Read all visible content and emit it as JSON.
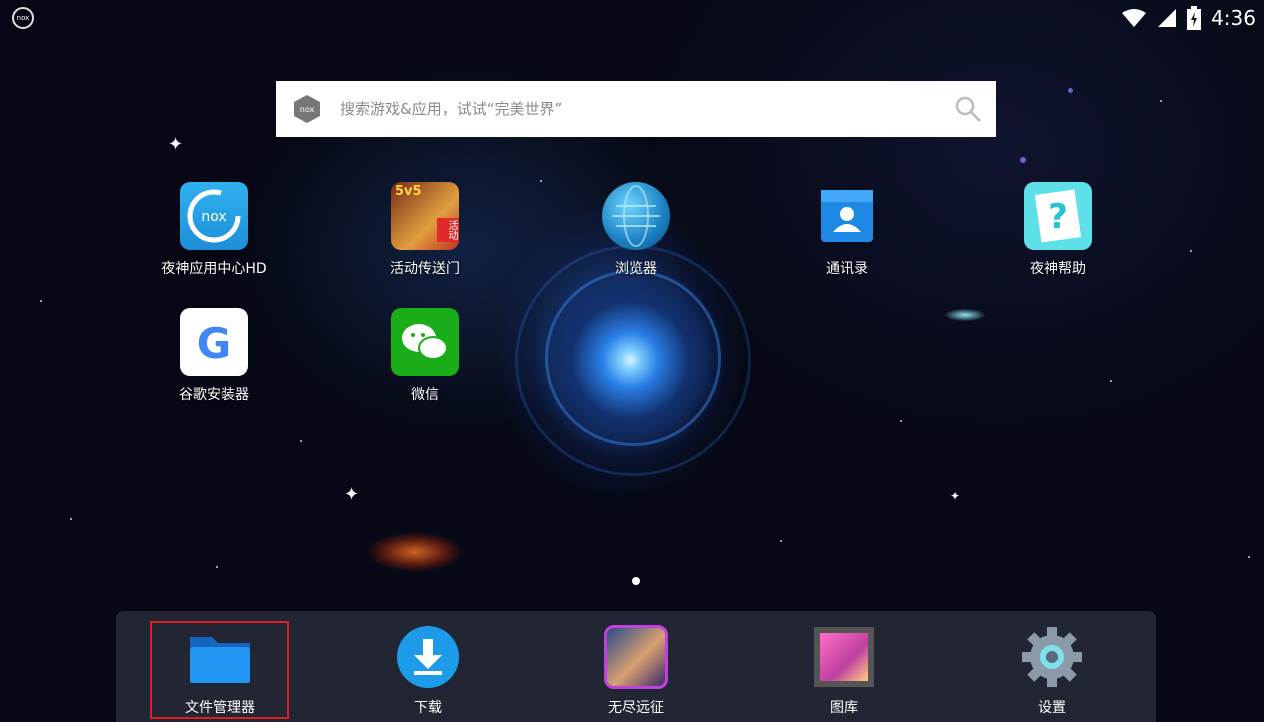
{
  "status_bar": {
    "time": "4:36"
  },
  "search": {
    "placeholder": "搜索游戏&应用，试试“完美世界”"
  },
  "apps": [
    {
      "label": "夜神应用中心HD",
      "icon": "nox-app-center-icon"
    },
    {
      "label": "活动传送门",
      "icon": "event-portal-icon"
    },
    {
      "label": "浏览器",
      "icon": "browser-globe-icon"
    },
    {
      "label": "通讯录",
      "icon": "contacts-icon"
    },
    {
      "label": "夜神帮助",
      "icon": "help-question-icon"
    },
    {
      "label": "谷歌安装器",
      "icon": "google-installer-icon"
    },
    {
      "label": "微信",
      "icon": "wechat-icon"
    }
  ],
  "event_badge": {
    "top": "5v5",
    "side": "活动"
  },
  "dock": [
    {
      "label": "文件管理器",
      "icon": "folder-icon"
    },
    {
      "label": "下载",
      "icon": "download-icon"
    },
    {
      "label": "无尽远征",
      "icon": "game-portrait-icon"
    },
    {
      "label": "图库",
      "icon": "gallery-icon"
    },
    {
      "label": "设置",
      "icon": "gear-icon"
    }
  ],
  "colors": {
    "highlight": "#e02020",
    "accent_blue": "#1e88e5"
  }
}
